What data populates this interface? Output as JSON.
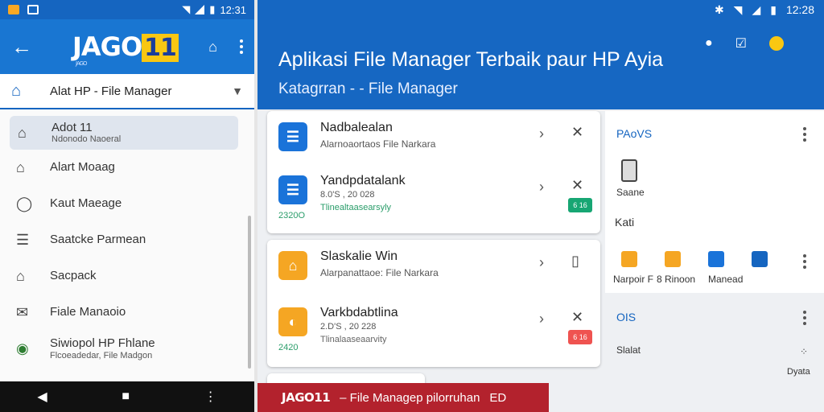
{
  "left_phone": {
    "status_time": "12:31",
    "brand_logo": "JAGO",
    "brand_num": "11",
    "brand_sub": "JAGO",
    "dropdown_label": "Alat HP - File Manager",
    "menu": [
      {
        "title": "Adot 11",
        "subtitle": "Ndonodo Naoeral",
        "icon": "home-icon"
      },
      {
        "title": "Alart Moaag",
        "subtitle": "",
        "icon": "notification-icon"
      },
      {
        "title": "Kaut Maeage",
        "subtitle": "",
        "icon": "location-icon"
      },
      {
        "title": "Saatcke Parmean",
        "subtitle": "",
        "icon": "document-icon"
      },
      {
        "title": "Sacpack",
        "subtitle": "",
        "icon": "backpack-icon"
      },
      {
        "title": "Fiale Manaoio",
        "subtitle": "",
        "icon": "mail-icon"
      },
      {
        "title": "Siwiopol HP Fhlane",
        "subtitle": "Flcoeadedar, File Madgon",
        "icon": "app-icon"
      }
    ]
  },
  "right_pane": {
    "status_time": "12:28",
    "title": "Aplikasi File Manager Terbaik paur HP Ayia",
    "subtitle": "Katagrran - - File Manager",
    "cards": [
      {
        "rows": [
          {
            "name": "Nadbalealan",
            "desc": "Alarnoaortaos File Narkara",
            "meta": "",
            "meta2": "",
            "stamp": "",
            "pill": ""
          },
          {
            "name": "Yandpdatalank",
            "desc": "",
            "meta": "8.0'S , 20 028",
            "meta2": "Tlinealtaasearsyly",
            "stamp": "2320O",
            "pill": "6 16"
          }
        ]
      },
      {
        "rows": [
          {
            "name": "Slaskalie Win",
            "desc": "Alarpanattaoe: File Narkara",
            "meta": "",
            "meta2": "",
            "stamp": "",
            "pill": ""
          },
          {
            "name": "Varkbdabtlina",
            "desc": "",
            "meta": "2.D'S , 20 228",
            "meta2": "Tlinalaaseaarvity",
            "stamp": "2420",
            "pill": "6 16"
          }
        ]
      }
    ],
    "side": {
      "section1_title": "PAoVS",
      "device_label": "Saane",
      "kati_label": "Kati",
      "tool_labels": [
        "Narpoir F",
        "8 Rinoon",
        "Manead"
      ],
      "section2_title": "OIS",
      "slalat_label": "Slalat",
      "dyata_label": "Dyata"
    },
    "banner": {
      "brand": "JAGO11",
      "text": "– File Managep pilorruhan",
      "tail": "ED"
    }
  },
  "colors": {
    "primary_blue": "#1976d2",
    "header_blue": "#1667c2",
    "accent_yellow": "#f9c712",
    "banner_red": "#b3222d",
    "pill_green": "#17a673",
    "pill_red": "#ef5350"
  }
}
